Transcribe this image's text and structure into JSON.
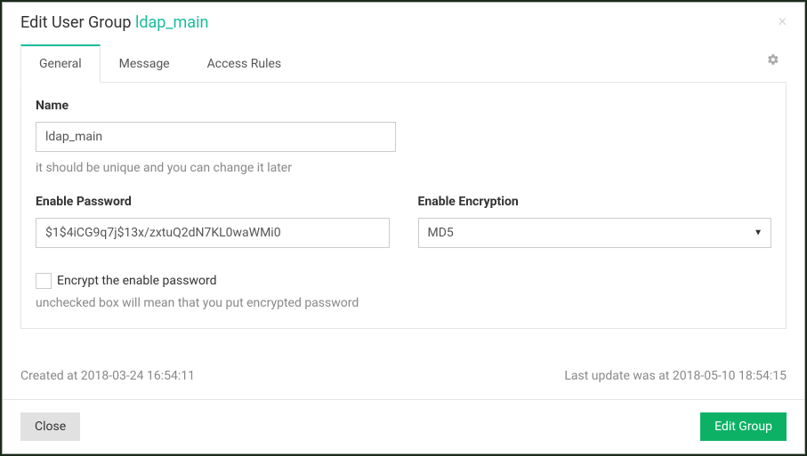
{
  "header": {
    "title_prefix": "Edit User Group ",
    "group_name": "ldap_main"
  },
  "tabs": [
    {
      "label": "General",
      "active": true
    },
    {
      "label": "Message",
      "active": false
    },
    {
      "label": "Access Rules",
      "active": false
    }
  ],
  "form": {
    "name_label": "Name",
    "name_value": "ldap_main",
    "name_help": "it should be unique and you can change it later",
    "password_label": "Enable Password",
    "password_value": "$1$4iCG9q7j$13x/zxtuQ2dN7KL0waWMi0",
    "encryption_label": "Enable Encryption",
    "encryption_value": "MD5",
    "encrypt_checkbox_label": "Encrypt the enable password",
    "encrypt_checkbox_checked": false,
    "encrypt_help": "unchecked box will mean that you put encrypted password"
  },
  "meta": {
    "created": "Created at 2018-03-24 16:54:11",
    "updated": "Last update was at 2018-05-10 18:54:15"
  },
  "footer": {
    "close_label": "Close",
    "submit_label": "Edit Group"
  }
}
